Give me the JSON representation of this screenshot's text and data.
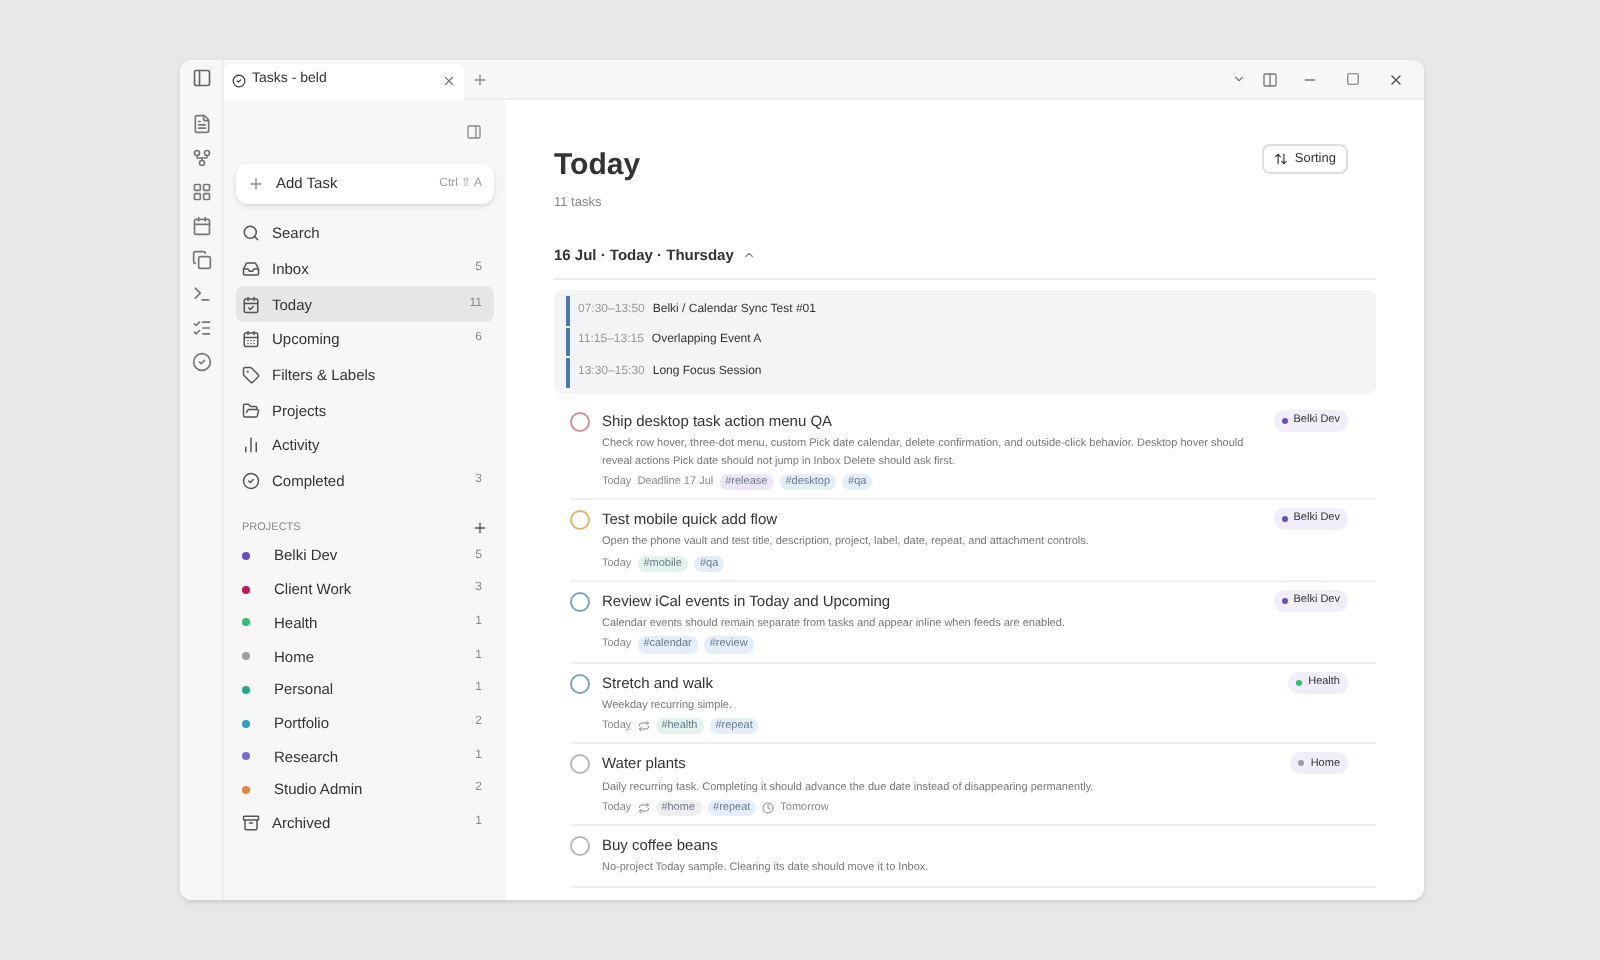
{
  "tab": {
    "title": "Tasks - beld"
  },
  "sidebar": {
    "add_task": {
      "label": "Add Task",
      "shortcut": "Ctrl ⇧ A"
    },
    "nav": [
      {
        "kind": "search",
        "label": "Search",
        "selected": false
      },
      {
        "kind": "inbox",
        "label": "Inbox",
        "count": "5",
        "selected": false
      },
      {
        "kind": "today",
        "label": "Today",
        "count": "11",
        "selected": true
      },
      {
        "kind": "upcoming",
        "label": "Upcoming",
        "count": "6",
        "selected": false
      },
      {
        "kind": "filters",
        "label": "Filters & Labels",
        "selected": false
      },
      {
        "kind": "projects",
        "label": "Projects",
        "selected": false
      },
      {
        "kind": "activity",
        "label": "Activity",
        "selected": false
      },
      {
        "kind": "completed",
        "label": "Completed",
        "count": "3",
        "selected": false
      }
    ],
    "projects_heading": "PROJECTS",
    "projects": [
      {
        "name": "Belki Dev",
        "count": "5",
        "color": "#6d4bc4"
      },
      {
        "name": "Client Work",
        "count": "3",
        "color": "#c2185b"
      },
      {
        "name": "Health",
        "count": "1",
        "color": "#2fbf71"
      },
      {
        "name": "Home",
        "count": "1",
        "color": "#9e9e9e"
      },
      {
        "name": "Personal",
        "count": "1",
        "color": "#1faa8c"
      },
      {
        "name": "Portfolio",
        "count": "2",
        "color": "#2aa1c9"
      },
      {
        "name": "Research",
        "count": "1",
        "color": "#7b68d9"
      },
      {
        "name": "Studio Admin",
        "count": "2",
        "color": "#e08a3c"
      }
    ],
    "archived": {
      "label": "Archived",
      "count": "1"
    }
  },
  "main": {
    "title": "Today",
    "subtitle": "11 tasks",
    "sort_button": "Sorting",
    "section": "16 Jul · Today · Thursday",
    "events": [
      {
        "time": "07:30–13:50",
        "title": "Belki / Calendar Sync Test #01"
      },
      {
        "time": "11:15–13:15",
        "title": "Overlapping Event A"
      },
      {
        "time": "13:30–15:30",
        "title": "Long Focus Session"
      }
    ],
    "tasks": [
      {
        "title": "Ship desktop task action menu QA",
        "color": "#d98a8a",
        "description": "Check row hover, three-dot menu, custom Pick date calendar, delete confirmation, and outside-click behavior. Desktop hover should reveal actions Pick date should not jump in Inbox Delete should ask first.",
        "date": "Today",
        "repeating": false,
        "extra": "Deadline 17 Jul",
        "tags": [
          {
            "label": "#release",
            "color": "#ece6f8"
          },
          {
            "label": "#desktop",
            "color": "#e3eef8"
          },
          {
            "label": "#qa",
            "color": "#e3eef8"
          }
        ],
        "project": {
          "name": "Belki Dev",
          "color": "#6d4bc4"
        }
      },
      {
        "title": "Test mobile quick add flow",
        "color": "#e0b56a",
        "description": "Open the phone vault and test title, description, project, label, date, repeat, and attachment controls.",
        "date": "Today",
        "repeating": false,
        "tags": [
          {
            "label": "#mobile",
            "color": "#e2f3ea"
          },
          {
            "label": "#qa",
            "color": "#e3eef8"
          }
        ],
        "project": {
          "name": "Belki Dev",
          "color": "#6d4bc4"
        }
      },
      {
        "title": "Review iCal events in Today and Upcoming",
        "color": "#7aa3c8",
        "description": "Calendar events should remain separate from tasks and appear inline when feeds are enabled.",
        "date": "Today",
        "repeating": false,
        "tags": [
          {
            "label": "#calendar",
            "color": "#e3eef8"
          },
          {
            "label": "#review",
            "color": "#e3eef8"
          }
        ],
        "project": {
          "name": "Belki Dev",
          "color": "#6d4bc4"
        }
      },
      {
        "title": "Stretch and walk",
        "color": "#7aa3c8",
        "description": "Weekday recurring simple.",
        "date": "Today",
        "repeating": true,
        "tags": [
          {
            "label": "#health",
            "color": "#e2f3ea"
          },
          {
            "label": "#repeat",
            "color": "#e3eef8"
          }
        ],
        "project": {
          "name": "Health",
          "color": "#2fbf71"
        }
      },
      {
        "title": "Water plants",
        "color": "#b8b8b8",
        "description": "Daily recurring task. Completing it should advance the due date instead of disappearing permanently.",
        "date": "Today",
        "repeating": true,
        "tags": [
          {
            "label": "#home",
            "color": "#eeeeee"
          },
          {
            "label": "#repeat",
            "color": "#e3eef8"
          }
        ],
        "extra": "Tomorrow",
        "project": {
          "name": "Home",
          "color": "#9e9e9e"
        }
      },
      {
        "title": "Buy coffee beans",
        "color": "#b8b8b8",
        "description": "No-project Today sample. Clearing its date should move it to Inbox."
      }
    ]
  }
}
